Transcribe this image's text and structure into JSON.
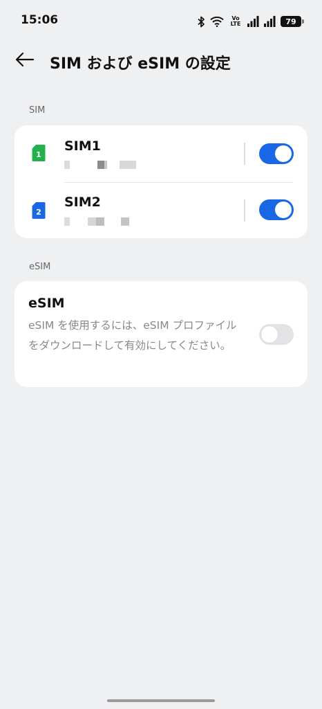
{
  "status_bar": {
    "time": "15:06",
    "volte_line1": "Vo",
    "volte_line2": "LTE",
    "battery": "79",
    "icons": [
      "bluetooth-icon",
      "wifi-icon",
      "volte-icon",
      "signal-icon",
      "signal-icon",
      "battery-icon"
    ]
  },
  "header": {
    "title": "SIM および eSIM の設定",
    "back_icon": "back-arrow-icon"
  },
  "sim_section": {
    "label": "SIM",
    "items": [
      {
        "icon_text": "1",
        "icon_color": "#22b14c",
        "name": "SIM1",
        "enabled": true
      },
      {
        "icon_text": "2",
        "icon_color": "#1a67e6",
        "name": "SIM2",
        "enabled": true
      }
    ]
  },
  "esim_section": {
    "label": "eSIM",
    "title": "eSIM",
    "description": "eSIM を使用するには、eSIM プロファイルをダウンロードして有効にしてください。",
    "enabled": false
  },
  "colors": {
    "accent": "#1a67e6",
    "background": "#eff0f2",
    "card": "#ffffff"
  }
}
